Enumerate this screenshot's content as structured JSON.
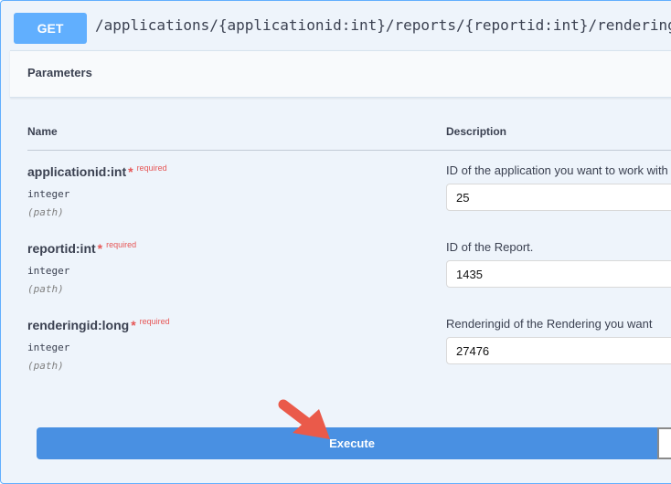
{
  "operation": {
    "method": "GET",
    "path": "/applications/{applicationid:int}/reports/{reportid:int}/renderings/{renderingid:long}"
  },
  "parameters_section": {
    "title": "Parameters",
    "col_name": "Name",
    "col_description": "Description",
    "items": [
      {
        "name": "applicationid:int",
        "required_star": "*",
        "required_label": "required",
        "type": "integer",
        "in": "(path)",
        "description": "ID of the application you want to work with",
        "value": "25"
      },
      {
        "name": "reportid:int",
        "required_star": "*",
        "required_label": "required",
        "type": "integer",
        "in": "(path)",
        "description": "ID of the Report.",
        "value": "1435"
      },
      {
        "name": "renderingid:long",
        "required_star": "*",
        "required_label": "required",
        "type": "integer",
        "in": "(path)",
        "description": "Renderingid of the Rendering you want",
        "value": "27476"
      }
    ]
  },
  "actions": {
    "execute_label": "Execute"
  },
  "colors": {
    "get_accent": "#61affe",
    "execute_bg": "#4990e2",
    "required": "#e65656",
    "annotation_arrow": "#ea5a4a"
  }
}
